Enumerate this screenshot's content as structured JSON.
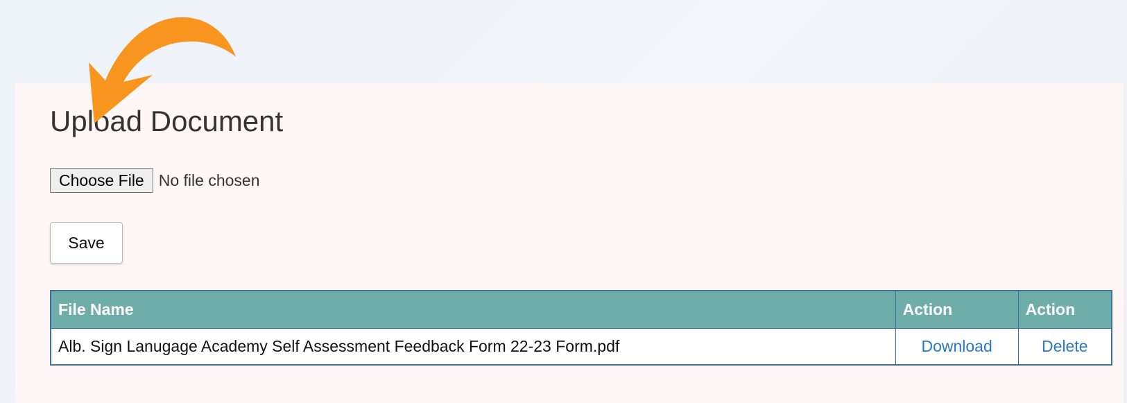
{
  "page": {
    "title": "Upload Document"
  },
  "upload": {
    "choose_file_label": "Choose File",
    "file_status": "No file chosen",
    "save_label": "Save"
  },
  "table": {
    "headers": [
      "File Name",
      "Action",
      "Action"
    ],
    "rows": [
      {
        "file_name": "Alb. Sign Lanugage Academy Self Assessment Feedback Form 22-23 Form.pdf",
        "download_label": "Download",
        "delete_label": "Delete"
      }
    ]
  },
  "colors": {
    "accent_arrow": "#f7951e",
    "table_header": "#6fada9",
    "link": "#2a78c9",
    "table_border": "#3d6fa8"
  },
  "icons": {
    "annotation": "curved-arrow-icon"
  }
}
